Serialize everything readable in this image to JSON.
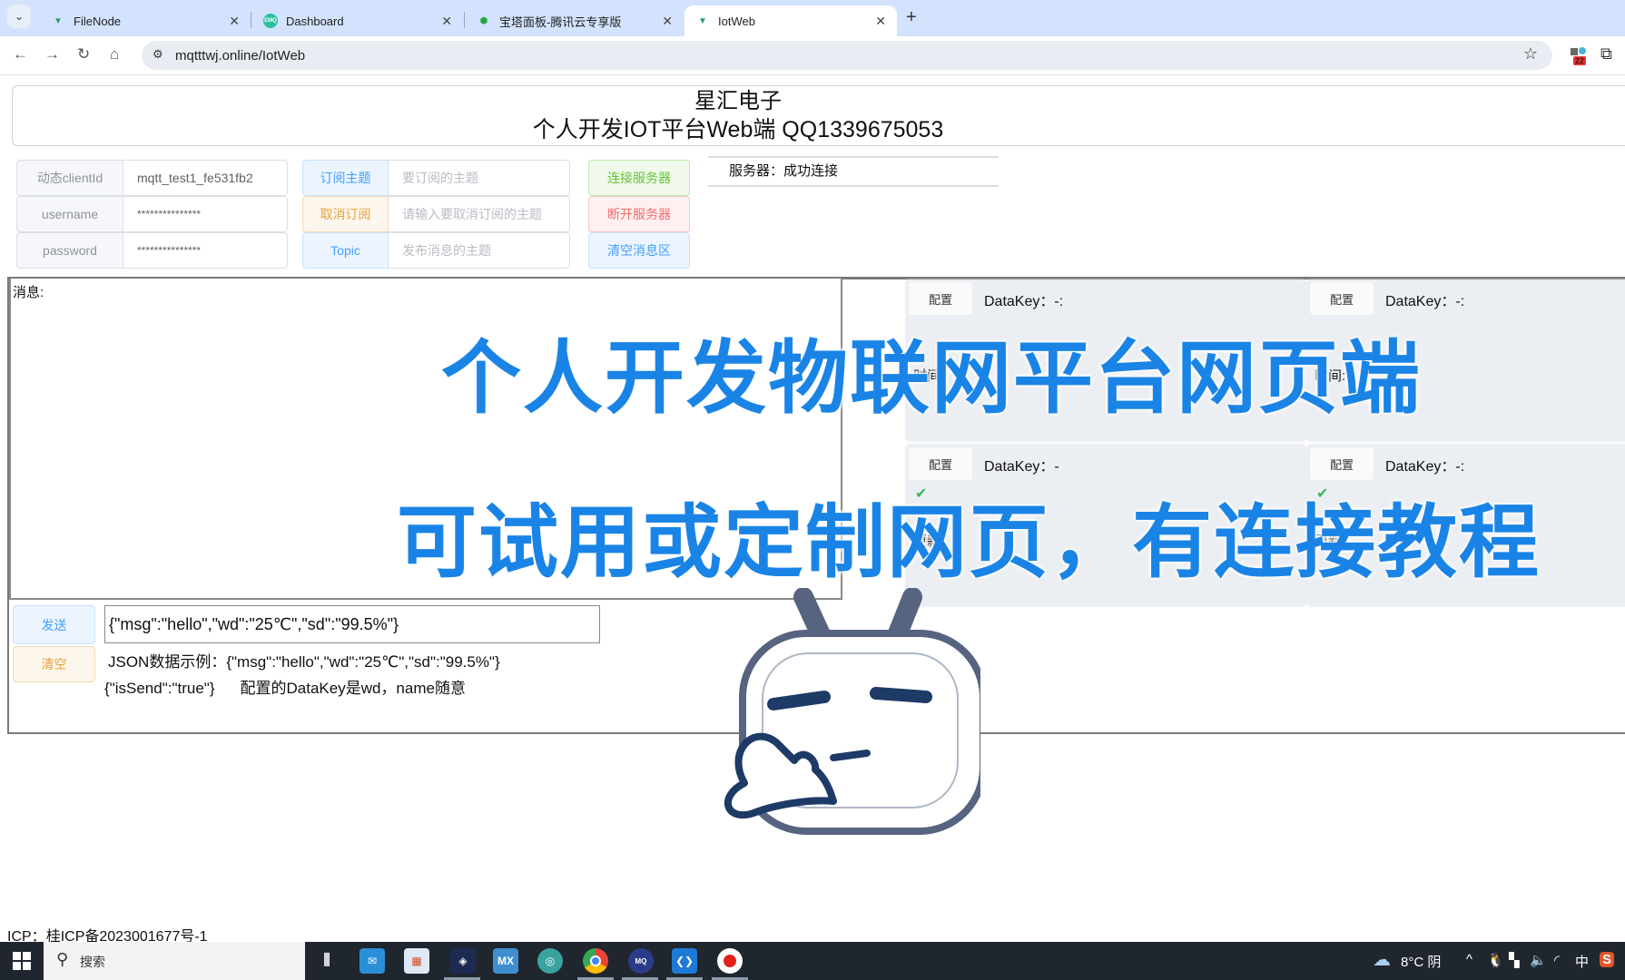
{
  "browser": {
    "tabs": [
      {
        "title": "FileNode",
        "icon": "vue-logo-icon",
        "active": false
      },
      {
        "title": "Dashboard",
        "icon": "emqx-icon",
        "active": false
      },
      {
        "title": "宝塔面板-腾讯云专享版",
        "icon": "shield-icon",
        "active": false
      },
      {
        "title": "IotWeb",
        "icon": "vue-logo-icon",
        "active": true
      }
    ],
    "url": "mqtttwj.online/IotWeb",
    "extension_badge": "22",
    "close_glyph": "✕",
    "new_tab_glyph": "+"
  },
  "header": {
    "title": "星汇电子",
    "subtitle": "个人开发IOT平台Web端 QQ1339675053"
  },
  "connection_form": {
    "client_id_label": "动态clientId",
    "client_id_value": "mqtt_test1_fe531fb2",
    "username_label": "username",
    "username_value": "***************",
    "password_label": "password",
    "password_value": "***************"
  },
  "topic_form": {
    "subscribe_button": "订阅主题",
    "subscribe_placeholder": "要订阅的主题",
    "unsubscribe_button": "取消订阅",
    "unsubscribe_placeholder": "请输入要取消订阅的主题",
    "topic_label": "Topic",
    "topic_placeholder": "发布消息的主题"
  },
  "actions": {
    "connect": "连接服务器",
    "disconnect": "断开服务器",
    "clear_messages": "清空消息区"
  },
  "server_status": "服务器：成功连接",
  "messages": {
    "label": "消息:"
  },
  "data_cards": [
    {
      "config_label": "配置",
      "datakey": "DataKey：-:",
      "time_label": "时间:"
    },
    {
      "config_label": "配置",
      "datakey": "DataKey：-:",
      "time_label": "时间:"
    },
    {
      "config_label": "配置",
      "datakey": "DataKey：-",
      "time_label": "更新:"
    },
    {
      "config_label": "配置",
      "datakey": "DataKey：-:",
      "time_label": "更新:"
    }
  ],
  "send": {
    "send_button": "发送",
    "clear_button": "清空",
    "input_value": "{\"msg\":\"hello\",\"wd\":\"25℃\",\"sd\":\"99.5%\"}",
    "hint_line1": "JSON数据示例：{\"msg\":\"hello\",\"wd\":\"25℃\",\"sd\":\"99.5%\"}",
    "hint_line2a": "{\"isSend\":\"true\"}",
    "hint_line2b": "配置的DataKey是wd，name随意"
  },
  "overlay": {
    "line1": "个人开发物联网平台网页端",
    "line2": "可试用或定制网页，有连接教程"
  },
  "footer": {
    "icp_label": "ICP：",
    "icp_link": "桂ICP备2023001677号-1"
  },
  "taskbar": {
    "search_placeholder": "搜索",
    "weather": "8°C 阴",
    "ime": "中",
    "apps": [
      {
        "name": "task-view",
        "label": ""
      },
      {
        "name": "mail",
        "label": ""
      },
      {
        "name": "store",
        "label": ""
      },
      {
        "name": "game-app",
        "label": ""
      },
      {
        "name": "mx-app",
        "label": "MX"
      },
      {
        "name": "edge-beta",
        "label": ""
      },
      {
        "name": "chrome",
        "label": ""
      },
      {
        "name": "mqtt-app",
        "label": ""
      },
      {
        "name": "vscode",
        "label": ""
      },
      {
        "name": "recorder",
        "label": ""
      }
    ]
  },
  "colors": {
    "primary": "#409eff",
    "success": "#67c23a",
    "warning": "#e6a23c",
    "danger": "#f56c6c",
    "info_teal": "#409eff",
    "overlay_blue": "#1a84e6"
  }
}
